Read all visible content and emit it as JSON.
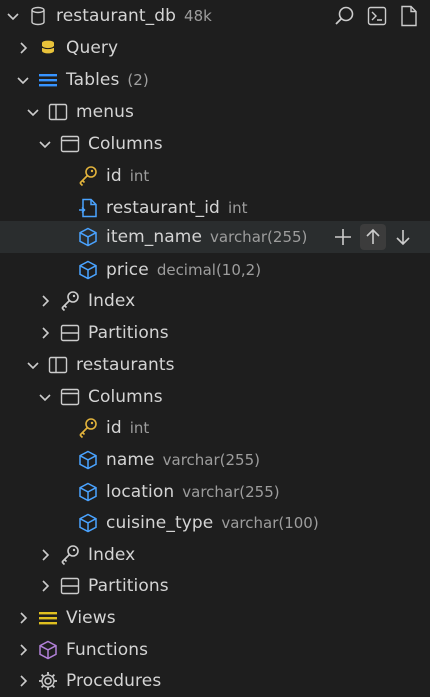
{
  "connection": {
    "name": "restaurant_db",
    "size": "48k"
  },
  "query_label": "Query",
  "tables": {
    "label": "Tables",
    "count": "(2)"
  },
  "menus": {
    "name": "menus",
    "columns_label": "Columns",
    "columns": [
      {
        "name": "id",
        "type": "int"
      },
      {
        "name": "restaurant_id",
        "type": "int"
      },
      {
        "name": "item_name",
        "type": "varchar(255)"
      },
      {
        "name": "price",
        "type": "decimal(10,2)"
      }
    ],
    "index_label": "Index",
    "partitions_label": "Partitions"
  },
  "restaurants": {
    "name": "restaurants",
    "columns_label": "Columns",
    "columns": [
      {
        "name": "id",
        "type": "int"
      },
      {
        "name": "name",
        "type": "varchar(255)"
      },
      {
        "name": "location",
        "type": "varchar(255)"
      },
      {
        "name": "cuisine_type",
        "type": "varchar(100)"
      }
    ],
    "index_label": "Index",
    "partitions_label": "Partitions"
  },
  "views_label": "Views",
  "functions_label": "Functions",
  "procedures_label": "Procedures",
  "icons": {
    "database": "database-icon",
    "search": "search-icon",
    "terminal": "terminal-icon",
    "file": "file-icon",
    "query": "stack-icon",
    "tables": "list-icon",
    "table": "table-icon",
    "columns": "window-icon",
    "primary_key": "key-icon",
    "foreign_key": "foreign-key-icon",
    "column": "cube-icon",
    "index": "key-icon",
    "partitions": "partition-icon",
    "views": "list-icon",
    "functions": "box-icon",
    "procedures": "gear-icon"
  },
  "colors": {
    "background": "#1e1e1e",
    "hover_row": "#2a2d2e",
    "key_yellow": "#e2b33c",
    "column_blue": "#4aa3ff",
    "query_yellow": "#e8c23a",
    "tables_blue": "#3794ff",
    "views_yellow": "#e0c020",
    "functions_purple": "#b180d7"
  }
}
